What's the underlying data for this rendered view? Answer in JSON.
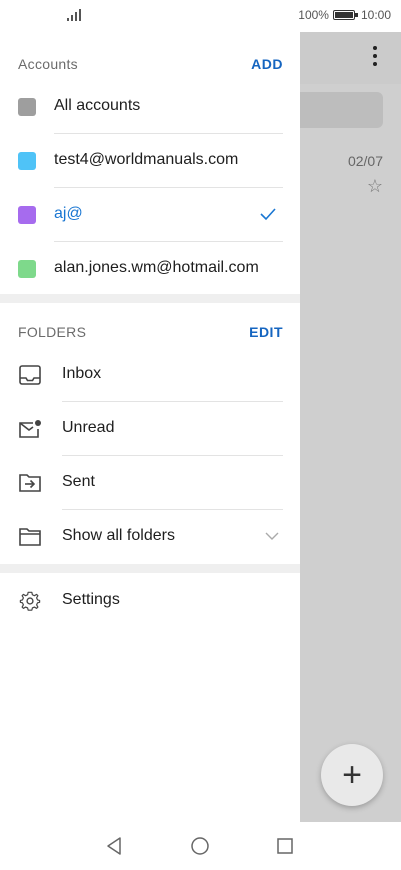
{
  "status_bar": {
    "battery_percent": "100%",
    "time": "10:00",
    "signal_icon": "signal-icon",
    "battery_icon": "battery-icon"
  },
  "background": {
    "date": "02/07",
    "star_icon": "star-icon",
    "menu_icon": "more-vertical-icon",
    "fab_label": "+"
  },
  "accounts": {
    "title": "Accounts",
    "action": "ADD",
    "items": [
      {
        "label": "All accounts",
        "color": "#9e9e9e",
        "selected": false
      },
      {
        "label": "test4@worldmanuals.com",
        "color": "#4fc3f7",
        "selected": false
      },
      {
        "label": "aj@",
        "color": "#a66bee",
        "selected": true
      },
      {
        "label": "alan.jones.wm@hotmail.com",
        "color": "#7ed98b",
        "selected": false
      }
    ]
  },
  "folders": {
    "title": "FOLDERS",
    "action": "EDIT",
    "items": [
      {
        "label": "Inbox",
        "icon": "inbox-icon"
      },
      {
        "label": "Unread",
        "icon": "unread-mail-icon"
      },
      {
        "label": "Sent",
        "icon": "sent-icon"
      },
      {
        "label": "Show all folders",
        "icon": "folders-icon"
      }
    ]
  },
  "settings": {
    "label": "Settings",
    "icon": "gear-icon"
  },
  "colors": {
    "accent": "#1565c0",
    "selected_text": "#1976d2"
  },
  "navbar": {
    "back_icon": "back-icon",
    "home_icon": "home-icon",
    "recents_icon": "recents-icon"
  }
}
